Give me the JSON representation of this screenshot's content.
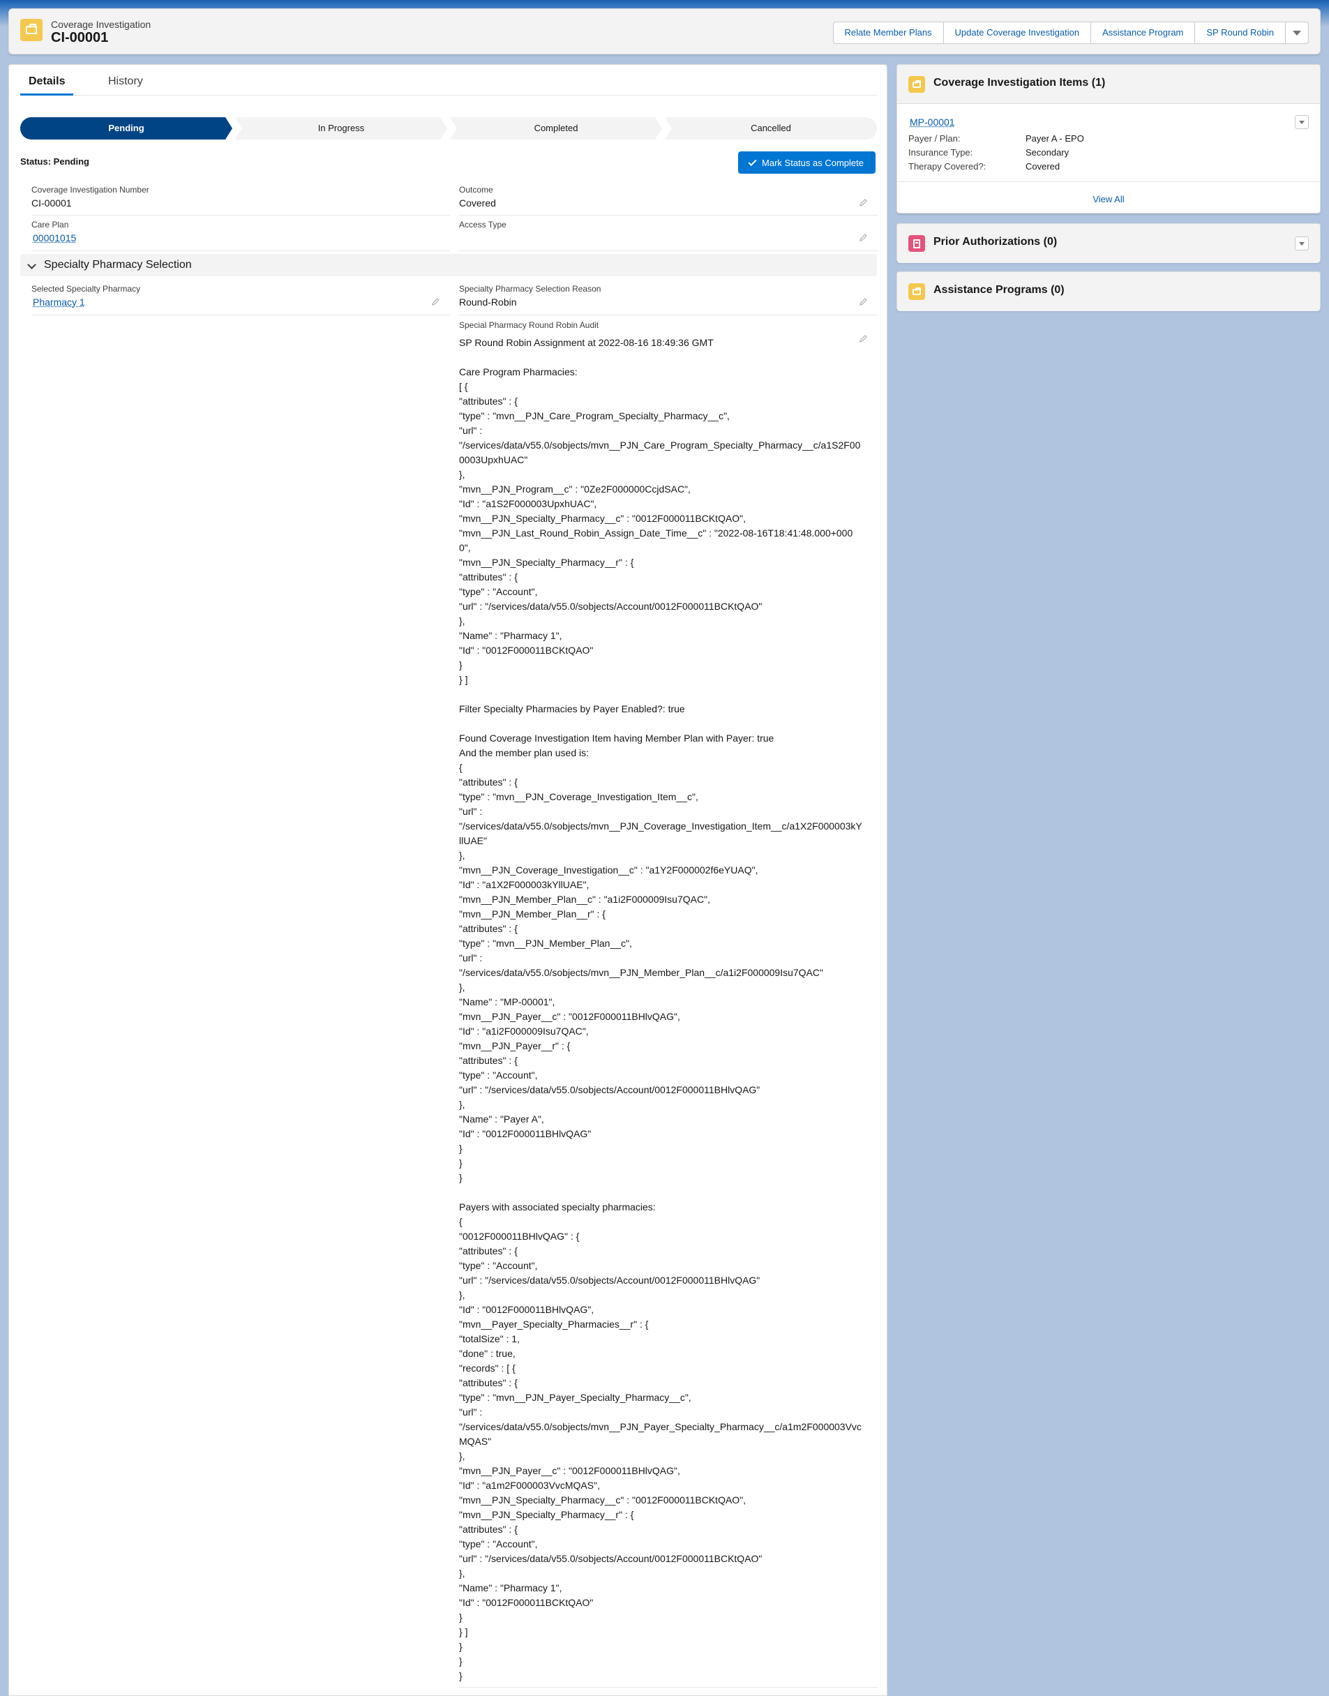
{
  "header": {
    "object_label": "Coverage Investigation",
    "record_name": "CI-00001",
    "actions": [
      "Relate Member Plans",
      "Update Coverage Investigation",
      "Assistance Program",
      "SP Round Robin"
    ]
  },
  "tabs": {
    "details": "Details",
    "history": "History"
  },
  "path": {
    "stages": [
      "Pending",
      "In Progress",
      "Completed",
      "Cancelled"
    ],
    "current": "Pending",
    "status_text": "Status: Pending",
    "complete_button": "Mark Status as Complete"
  },
  "fields": {
    "ci_number_label": "Coverage Investigation Number",
    "ci_number_value": "CI-00001",
    "outcome_label": "Outcome",
    "outcome_value": "Covered",
    "care_plan_label": "Care Plan",
    "care_plan_value": "00001015",
    "access_type_label": "Access Type",
    "access_type_value": ""
  },
  "section": {
    "title": "Specialty Pharmacy Selection",
    "selected_pharmacy_label": "Selected Specialty Pharmacy",
    "selected_pharmacy_value": "Pharmacy 1",
    "reason_label": "Specialty Pharmacy Selection Reason",
    "reason_value": "Round-Robin",
    "audit_label": "Special Pharmacy Round Robin Audit",
    "audit_value": "SP Round Robin Assignment at 2022-08-16 18:49:36 GMT\n\nCare Program Pharmacies:\n[ {\n\"attributes\" : {\n\"type\" : \"mvn__PJN_Care_Program_Specialty_Pharmacy__c\",\n\"url\" :\n\"/services/data/v55.0/sobjects/mvn__PJN_Care_Program_Specialty_Pharmacy__c/a1S2F000003UpxhUAC\"\n},\n\"mvn__PJN_Program__c\" : \"0Ze2F000000CcjdSAC\",\n\"Id\" : \"a1S2F000003UpxhUAC\",\n\"mvn__PJN_Specialty_Pharmacy__c\" : \"0012F000011BCKtQAO\",\n\"mvn__PJN_Last_Round_Robin_Assign_Date_Time__c\" : \"2022-08-16T18:41:48.000+0000\",\n\"mvn__PJN_Specialty_Pharmacy__r\" : {\n\"attributes\" : {\n\"type\" : \"Account\",\n\"url\" : \"/services/data/v55.0/sobjects/Account/0012F000011BCKtQAO\"\n},\n\"Name\" : \"Pharmacy 1\",\n\"Id\" : \"0012F000011BCKtQAO\"\n}\n} ]\n\nFilter Specialty Pharmacies by Payer Enabled?: true\n\nFound Coverage Investigation Item having Member Plan with Payer: true\nAnd the member plan used is:\n{\n\"attributes\" : {\n\"type\" : \"mvn__PJN_Coverage_Investigation_Item__c\",\n\"url\" :\n\"/services/data/v55.0/sobjects/mvn__PJN_Coverage_Investigation_Item__c/a1X2F000003kYllUAE\"\n},\n\"mvn__PJN_Coverage_Investigation__c\" : \"a1Y2F000002f6eYUAQ\",\n\"Id\" : \"a1X2F000003kYllUAE\",\n\"mvn__PJN_Member_Plan__c\" : \"a1i2F000009Isu7QAC\",\n\"mvn__PJN_Member_Plan__r\" : {\n\"attributes\" : {\n\"type\" : \"mvn__PJN_Member_Plan__c\",\n\"url\" :\n\"/services/data/v55.0/sobjects/mvn__PJN_Member_Plan__c/a1i2F000009Isu7QAC\"\n},\n\"Name\" : \"MP-00001\",\n\"mvn__PJN_Payer__c\" : \"0012F000011BHlvQAG\",\n\"Id\" : \"a1i2F000009Isu7QAC\",\n\"mvn__PJN_Payer__r\" : {\n\"attributes\" : {\n\"type\" : \"Account\",\n\"url\" : \"/services/data/v55.0/sobjects/Account/0012F000011BHlvQAG\"\n},\n\"Name\" : \"Payer A\",\n\"Id\" : \"0012F000011BHlvQAG\"\n}\n}\n}\n\nPayers with associated specialty pharmacies:\n{\n\"0012F000011BHlvQAG\" : {\n\"attributes\" : {\n\"type\" : \"Account\",\n\"url\" : \"/services/data/v55.0/sobjects/Account/0012F000011BHlvQAG\"\n},\n\"Id\" : \"0012F000011BHlvQAG\",\n\"mvn__Payer_Specialty_Pharmacies__r\" : {\n\"totalSize\" : 1,\n\"done\" : true,\n\"records\" : [ {\n\"attributes\" : {\n\"type\" : \"mvn__PJN_Payer_Specialty_Pharmacy__c\",\n\"url\" :\n\"/services/data/v55.0/sobjects/mvn__PJN_Payer_Specialty_Pharmacy__c/a1m2F000003VvcMQAS\"\n},\n\"mvn__PJN_Payer__c\" : \"0012F000011BHlvQAG\",\n\"Id\" : \"a1m2F000003VvcMQAS\",\n\"mvn__PJN_Specialty_Pharmacy__c\" : \"0012F000011BCKtQAO\",\n\"mvn__PJN_Specialty_Pharmacy__r\" : {\n\"attributes\" : {\n\"type\" : \"Account\",\n\"url\" : \"/services/data/v55.0/sobjects/Account/0012F000011BCKtQAO\"\n},\n\"Name\" : \"Pharmacy 1\",\n\"Id\" : \"0012F000011BCKtQAO\"\n}\n} ]\n}\n}\n}"
  },
  "right": {
    "items_title": "Coverage Investigation Items (1)",
    "item_name": "MP-00001",
    "payer_plan_label": "Payer / Plan:",
    "payer_plan_value": "Payer A - EPO",
    "insurance_type_label": "Insurance Type:",
    "insurance_type_value": "Secondary",
    "therapy_label": "Therapy Covered?:",
    "therapy_value": "Covered",
    "view_all": "View All",
    "prior_auth_title": "Prior Authorizations (0)",
    "assistance_title": "Assistance Programs (0)"
  },
  "icons": {
    "record_icon": "briefcase-icon",
    "prior_auth_icon": "document-icon",
    "edit_icon": "pencil-icon"
  },
  "colors": {
    "brand_blue": "#0176d3",
    "path_current": "#014486",
    "record_icon_yellow": "#f4c84f",
    "prior_auth_pink": "#e3547d",
    "link_blue": "#0b5cab",
    "background": "#b0c4df"
  }
}
